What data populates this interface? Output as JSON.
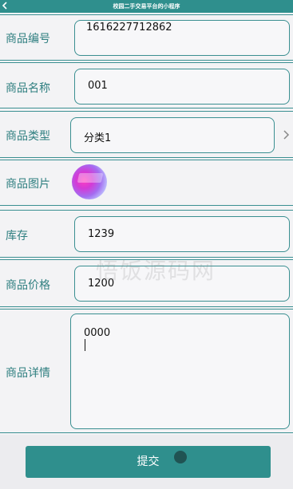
{
  "nav": {
    "title": "校园二手交易平台的小程序",
    "back_icon": "chevron-left-icon"
  },
  "form": {
    "product_id": {
      "label": "商品编号",
      "value": "1616227712862"
    },
    "product_name": {
      "label": "商品名称",
      "value": "001"
    },
    "product_type": {
      "label": "商品类型",
      "value": "分类1",
      "icon": "chevron-right-icon"
    },
    "product_image": {
      "label": "商品图片",
      "image": "product-thumbnail"
    },
    "stock": {
      "label": "库存",
      "value": "1239"
    },
    "price": {
      "label": "商品价格",
      "value": "1200"
    },
    "details": {
      "label": "商品详情",
      "value": "0000"
    }
  },
  "submit_label": "提交",
  "watermark": "悟饭源码网",
  "colors": {
    "accent": "#2f8f8d",
    "border": "#3a8f91",
    "label": "#2f7f80",
    "background": "#f3f3f5"
  }
}
